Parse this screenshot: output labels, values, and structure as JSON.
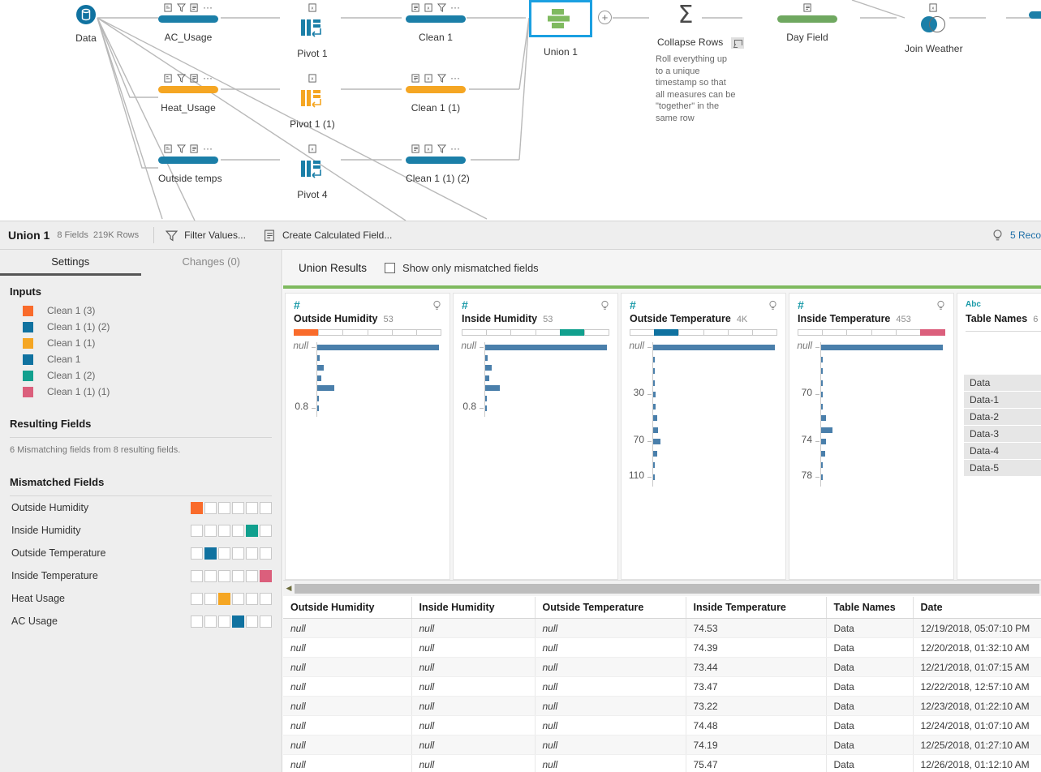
{
  "flow": {
    "source": {
      "label": "Data",
      "icon": "database-icon"
    },
    "steps": [
      {
        "label": "AC_Usage",
        "type": "clean",
        "color": "#1b7fa8",
        "icons": [
          "rename-field-icon",
          "filter-icon",
          "group-values-icon",
          "more-options-icon"
        ]
      },
      {
        "label": "Heat_Usage",
        "type": "clean",
        "color": "#f5a623",
        "icons": [
          "rename-field-icon",
          "filter-icon",
          "group-values-icon",
          "more-options-icon"
        ]
      },
      {
        "label": "Outside temps",
        "type": "clean",
        "color": "#1b7fa8",
        "icons": [
          "rename-field-icon",
          "filter-icon",
          "group-values-icon",
          "more-options-icon"
        ]
      },
      {
        "label": "Pivot 1",
        "type": "pivot",
        "color": "#1b7fa8",
        "icons": [
          "remove-field-icon"
        ]
      },
      {
        "label": "Pivot 1 (1)",
        "type": "pivot",
        "color": "#f5a623",
        "icons": [
          "remove-field-icon"
        ]
      },
      {
        "label": "Pivot 4",
        "type": "pivot",
        "color": "#1b7fa8",
        "icons": [
          "remove-field-icon"
        ]
      },
      {
        "label": "Clean 1",
        "type": "clean",
        "color": "#1b7fa8",
        "icons": [
          "group-values-icon",
          "remove-field-icon",
          "filter-icon",
          "more-options-icon"
        ]
      },
      {
        "label": "Clean 1 (1)",
        "type": "clean",
        "color": "#f5a623",
        "icons": [
          "group-values-icon",
          "remove-field-icon",
          "filter-icon",
          "more-options-icon"
        ]
      },
      {
        "label": "Clean 1 (1) (2)",
        "type": "clean",
        "color": "#1b7fa8",
        "icons": [
          "group-values-icon",
          "remove-field-icon",
          "filter-icon",
          "more-options-icon"
        ]
      },
      {
        "label": "Union 1",
        "type": "union",
        "selected": true
      },
      {
        "label": "Collapse Rows",
        "type": "aggregate",
        "note": "Roll everything up to a unique timestamp so that all measures can be \"together\" in the same row"
      },
      {
        "label": "Day Field",
        "type": "clean",
        "color": "#6fa860",
        "icons": [
          "group-values-icon"
        ]
      },
      {
        "label": "Join Weather",
        "type": "join",
        "icons": [
          "remove-field-icon"
        ]
      }
    ],
    "add_step_label": "+"
  },
  "action_bar": {
    "title": "Union 1",
    "fields": "8 Fields",
    "rows": "219K Rows",
    "filter_values": "Filter Values...",
    "create_calculated_field": "Create Calculated Field...",
    "recommendations": "5 Reco"
  },
  "left_panel": {
    "tabs": [
      {
        "label": "Settings",
        "active": true
      },
      {
        "label": "Changes (0)",
        "active": false
      }
    ],
    "inputs_title": "Inputs",
    "inputs": [
      {
        "label": "Clean 1 (3)",
        "color": "#f96b2b"
      },
      {
        "label": "Clean 1 (1) (2)",
        "color": "#1072a0"
      },
      {
        "label": "Clean 1 (1)",
        "color": "#f5a623"
      },
      {
        "label": "Clean 1",
        "color": "#1072a0"
      },
      {
        "label": "Clean 1 (2)",
        "color": "#11a08e"
      },
      {
        "label": "Clean 1 (1) (1)",
        "color": "#db5f7c"
      }
    ],
    "resulting_fields_title": "Resulting Fields",
    "resulting_fields_note": "6 Mismatching fields from 8 resulting fields.",
    "mismatched_title": "Mismatched Fields",
    "mismatched": [
      {
        "label": "Outside Humidity",
        "cells": [
          1,
          0,
          0,
          0,
          0,
          0
        ],
        "color": "#f96b2b"
      },
      {
        "label": "Inside Humidity",
        "cells": [
          0,
          0,
          0,
          0,
          1,
          0
        ],
        "color": "#11a08e"
      },
      {
        "label": "Outside Temperature",
        "cells": [
          0,
          1,
          0,
          0,
          0,
          0
        ],
        "color": "#1072a0"
      },
      {
        "label": "Inside Temperature",
        "cells": [
          0,
          0,
          0,
          0,
          0,
          1
        ],
        "color": "#db5f7c"
      },
      {
        "label": "Heat Usage",
        "cells": [
          0,
          0,
          1,
          0,
          0,
          0
        ],
        "color": "#f5a623"
      },
      {
        "label": "AC Usage",
        "cells": [
          0,
          0,
          0,
          1,
          0,
          0
        ],
        "color": "#1072a0"
      }
    ]
  },
  "results": {
    "title": "Union Results",
    "show_mismatched_label": "Show only mismatched fields",
    "show_mismatched_checked": false
  },
  "chart_data": [
    {
      "type": "bar",
      "title": "Outside Humidity",
      "field_type": "number",
      "distinct_count": "53",
      "source_segments": [
        1,
        0,
        0,
        0,
        0,
        0
      ],
      "source_segment_color": "#f96b2b",
      "categories": [
        "null",
        "",
        "",
        "",
        "",
        "",
        "0.8"
      ],
      "values": [
        100,
        2,
        5,
        3,
        14,
        1,
        1
      ],
      "tick_labels": {
        "0": "null",
        "6": "0.8"
      },
      "xlabel": "",
      "ylabel": ""
    },
    {
      "type": "bar",
      "title": "Inside Humidity",
      "field_type": "number",
      "distinct_count": "53",
      "source_segments": [
        0,
        0,
        0,
        0,
        1,
        0
      ],
      "source_segment_color": "#11a08e",
      "categories": [
        "null",
        "",
        "",
        "",
        "",
        "",
        "0.8"
      ],
      "values": [
        100,
        2,
        5,
        3,
        12,
        1,
        1
      ],
      "tick_labels": {
        "0": "null",
        "6": "0.8"
      },
      "xlabel": "",
      "ylabel": ""
    },
    {
      "type": "bar",
      "title": "Outside Temperature",
      "field_type": "number",
      "distinct_count": "4K",
      "source_segments": [
        0,
        1,
        0,
        0,
        0,
        0
      ],
      "source_segment_color": "#1072a0",
      "categories": [
        "null",
        "",
        "",
        "",
        "30",
        "",
        "",
        "",
        "70",
        "",
        "",
        "110"
      ],
      "values": [
        100,
        1,
        1,
        1,
        2,
        2,
        3,
        4,
        6,
        3,
        1,
        1
      ],
      "tick_labels": {
        "0": "null",
        "4": "30",
        "8": "70",
        "11": "110"
      },
      "xlabel": "",
      "ylabel": ""
    },
    {
      "type": "bar",
      "title": "Inside Temperature",
      "field_type": "number",
      "distinct_count": "453",
      "source_segments": [
        0,
        0,
        0,
        0,
        0,
        1
      ],
      "source_segment_color": "#db5f7c",
      "categories": [
        "null",
        "",
        "",
        "",
        "70",
        "",
        "",
        "",
        "74",
        "",
        "",
        "78"
      ],
      "values": [
        100,
        1,
        1,
        1,
        1,
        1,
        4,
        9,
        4,
        3,
        1,
        1
      ],
      "tick_labels": {
        "0": "null",
        "4": "70",
        "8": "74",
        "11": "78"
      },
      "xlabel": "",
      "ylabel": ""
    },
    {
      "type": "table",
      "title": "Table Names",
      "field_type": "text",
      "distinct_count": "6",
      "values": [
        "Data",
        "Data-1",
        "Data-2",
        "Data-3",
        "Data-4",
        "Data-5"
      ]
    }
  ],
  "grid": {
    "columns": [
      "Outside Humidity",
      "Inside Humidity",
      "Outside Temperature",
      "Inside Temperature",
      "Table Names",
      "Date"
    ],
    "rows": [
      [
        "null",
        "null",
        "null",
        "74.53",
        "Data",
        "12/19/2018, 05:07:10 PM"
      ],
      [
        "null",
        "null",
        "null",
        "74.39",
        "Data",
        "12/20/2018, 01:32:10 AM"
      ],
      [
        "null",
        "null",
        "null",
        "73.44",
        "Data",
        "12/21/2018, 01:07:15 AM"
      ],
      [
        "null",
        "null",
        "null",
        "73.47",
        "Data",
        "12/22/2018, 12:57:10 AM"
      ],
      [
        "null",
        "null",
        "null",
        "73.22",
        "Data",
        "12/23/2018, 01:22:10 AM"
      ],
      [
        "null",
        "null",
        "null",
        "74.48",
        "Data",
        "12/24/2018, 01:07:10 AM"
      ],
      [
        "null",
        "null",
        "null",
        "74.19",
        "Data",
        "12/25/2018, 01:27:10 AM"
      ],
      [
        "null",
        "null",
        "null",
        "75.47",
        "Data",
        "12/26/2018, 01:12:10 AM"
      ]
    ]
  }
}
